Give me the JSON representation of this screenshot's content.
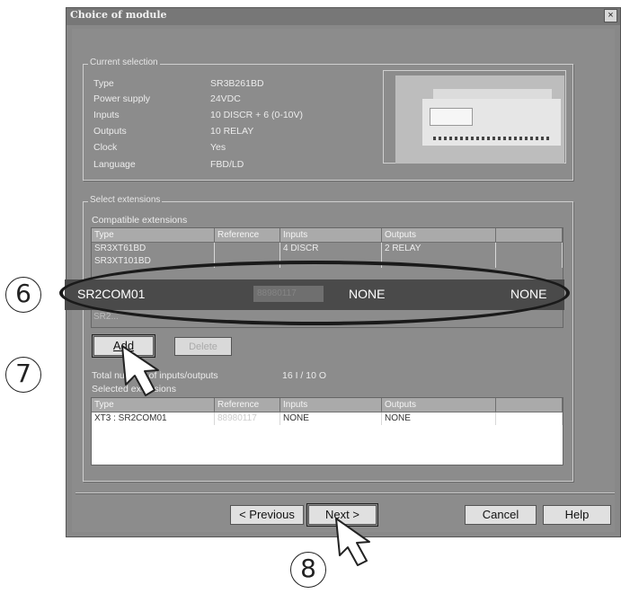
{
  "window": {
    "title": "Choice of module",
    "close_glyph": "×"
  },
  "current_selection": {
    "legend": "Current selection",
    "rows": [
      {
        "label": "Type",
        "value": "SR3B261BD"
      },
      {
        "label": "Power supply",
        "value": "24VDC"
      },
      {
        "label": "Inputs",
        "value": "10 DISCR + 6 (0-10V)"
      },
      {
        "label": "Outputs",
        "value": "10 RELAY"
      },
      {
        "label": "Clock",
        "value": "Yes"
      },
      {
        "label": "Language",
        "value": "FBD/LD"
      }
    ]
  },
  "select_extensions": {
    "legend": "Select extensions",
    "compatible_label": "Compatible extensions",
    "columns": [
      "Type",
      "Reference",
      "Inputs",
      "Outputs"
    ],
    "rows": [
      {
        "type": "SR3XT61BD",
        "reference": "",
        "inputs": "4 DISCR",
        "outputs": "2 RELAY"
      },
      {
        "type": "SR3XT101BD",
        "reference": "",
        "inputs": "",
        "outputs": ""
      }
    ],
    "highlighted": {
      "type": "SR2COM01",
      "reference": "88980117",
      "inputs": "NONE",
      "outputs": "NONE"
    },
    "partial_row": "SR2..."
  },
  "buttons": {
    "add": "Add",
    "delete": "Delete",
    "previous": "< Previous",
    "next": "Next >",
    "cancel": "Cancel",
    "help": "Help"
  },
  "totals": {
    "label": "Total number of inputs/outputs",
    "value": "16 I / 10 O",
    "selected_label": "Selected extensions"
  },
  "selected_table": {
    "columns": [
      "Type",
      "Reference",
      "Inputs",
      "Outputs"
    ],
    "rows": [
      {
        "type": "XT3 : SR2COM01",
        "reference": "88980117",
        "inputs": "NONE",
        "outputs": "NONE"
      }
    ]
  },
  "callouts": {
    "step6": "6",
    "step7": "7",
    "step8": "8"
  },
  "colors": {
    "dialog_bg": "#8c8c8c",
    "highlight_band": "#4a4a4a",
    "ellipse": "#1a1a1a"
  }
}
